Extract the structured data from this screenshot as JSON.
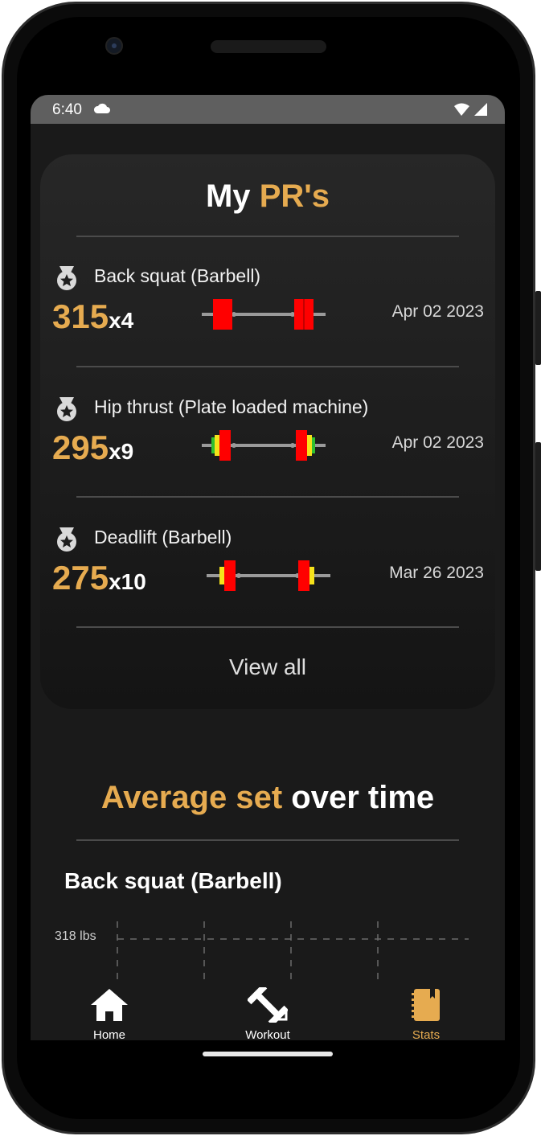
{
  "status_bar": {
    "time": "6:40"
  },
  "pr_card": {
    "title_white": "My",
    "title_gold": "PR's",
    "items": [
      {
        "name": "Back squat (Barbell)",
        "weight": "315",
        "reps": "x4",
        "date": "Apr 02 2023"
      },
      {
        "name": "Hip thrust (Plate loaded machine)",
        "weight": "295",
        "reps": "x9",
        "date": "Apr 02 2023"
      },
      {
        "name": "Deadlift (Barbell)",
        "weight": "275",
        "reps": "x10",
        "date": "Mar 26 2023"
      }
    ],
    "view_all": "View all"
  },
  "average_section": {
    "title_gold": "Average set",
    "title_white": "over time",
    "exercise": "Back squat (Barbell)"
  },
  "chart_data": {
    "type": "line",
    "title": "",
    "ylabel": "",
    "y_ticks": [
      "318 lbs"
    ],
    "series": []
  },
  "bottom_nav": {
    "items": [
      {
        "label": "Home",
        "icon": "home-icon"
      },
      {
        "label": "Workout",
        "icon": "dumbbell-icon"
      },
      {
        "label": "Stats",
        "icon": "notebook-icon"
      }
    ]
  },
  "colors": {
    "accent": "#e6ab50",
    "plate_red": "#ff0000",
    "plate_yellow": "#f5e21a",
    "plate_green": "#2fbf2f",
    "background": "#1a1a1a"
  }
}
